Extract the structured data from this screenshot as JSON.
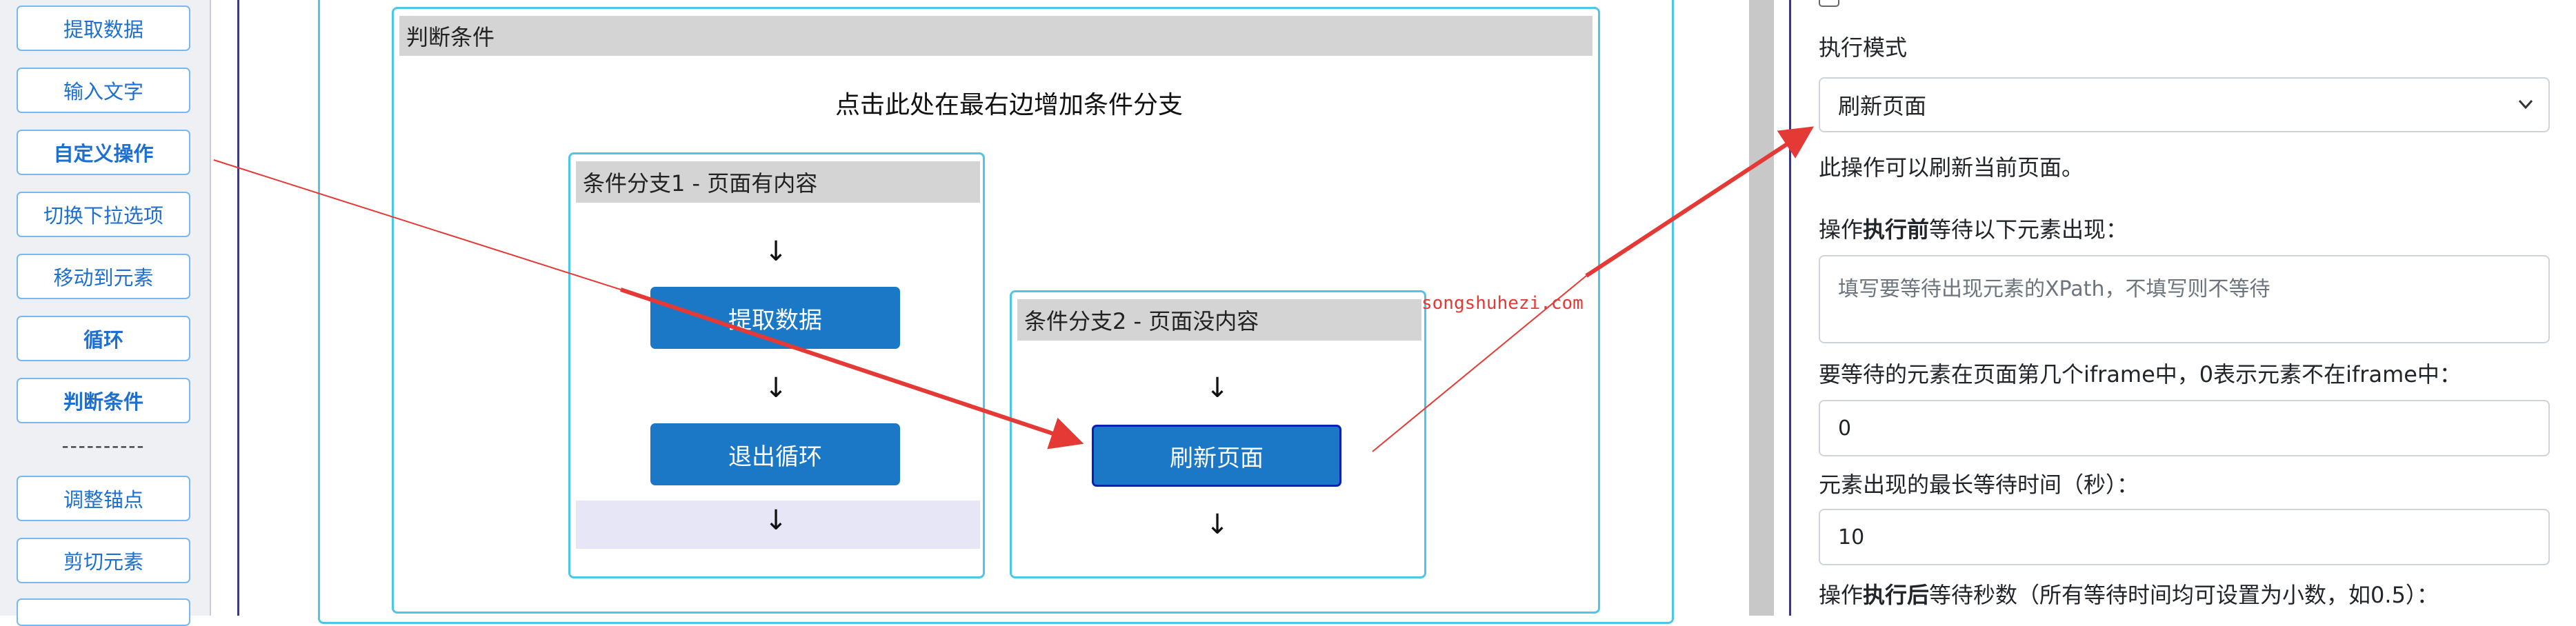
{
  "toolbox": {
    "items": [
      {
        "label": "提取数据",
        "bold": false
      },
      {
        "label": "输入文字",
        "bold": false
      },
      {
        "label": "自定义操作",
        "bold": true
      },
      {
        "label": "切换下拉选项",
        "bold": false
      },
      {
        "label": "移动到元素",
        "bold": false
      },
      {
        "label": "循环",
        "bold": true
      },
      {
        "label": "判断条件",
        "bold": true
      },
      {
        "label": "调整锚点",
        "bold": false
      },
      {
        "label": "剪切元素",
        "bold": false
      }
    ],
    "separator": "----------"
  },
  "flow": {
    "condition_title": "判断条件",
    "add_branch_hint": "点击此处在最右边增加条件分支",
    "arrow_glyph": "↓",
    "branch1": {
      "title": "条件分支1 - 页面有内容",
      "node1": "提取数据",
      "node2": "退出循环"
    },
    "branch2": {
      "title": "条件分支2 - 页面没内容",
      "node1": "刷新页面"
    },
    "watermark": "songshuhezi.com"
  },
  "props": {
    "exec_mode_label": "执行模式",
    "exec_mode_value": "刷新页面",
    "exec_mode_desc": "此操作可以刷新当前页面。",
    "wait_before_prefix": "操作",
    "wait_before_bold": "执行前",
    "wait_before_suffix": "等待以下元素出现：",
    "wait_xpath_placeholder": "填写要等待出现元素的XPath，不填写则不等待",
    "iframe_label": "要等待的元素在页面第几个iframe中，0表示元素不在iframe中：",
    "iframe_value": "0",
    "max_wait_label": "元素出现的最长等待时间（秒）：",
    "max_wait_value": "10",
    "wait_after_prefix": "操作",
    "wait_after_bold": "执行后",
    "wait_after_suffix": "等待秒数（所有等待时间均可设置为小数，如0.5）："
  },
  "colors": {
    "accent": "#1b78c6",
    "container_border": "#4ec6e6",
    "annotation_arrow": "#e53935"
  }
}
